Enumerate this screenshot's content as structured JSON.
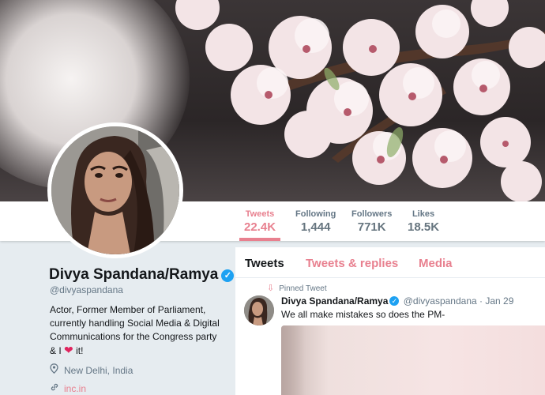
{
  "profile": {
    "name": "Divya Spandana/Ramya",
    "handle": "@divyaspandana",
    "bio_lines": [
      "Actor, Former Member of Parliament,",
      "currently handling Social Media & Digital",
      "Communications for the Congress party"
    ],
    "bio_end_prefix": "& I",
    "bio_end_suffix": "it!",
    "location": "New Delhi, India",
    "website": "inc.in"
  },
  "stats": [
    {
      "label": "Tweets",
      "value": "22.4K",
      "active": true
    },
    {
      "label": "Following",
      "value": "1,444",
      "active": false
    },
    {
      "label": "Followers",
      "value": "771K",
      "active": false
    },
    {
      "label": "Likes",
      "value": "18.5K",
      "active": false
    }
  ],
  "tabs": [
    {
      "label": "Tweets",
      "active": true
    },
    {
      "label": "Tweets & replies",
      "active": false
    },
    {
      "label": "Media",
      "active": false
    }
  ],
  "pinned_tweet": {
    "pinned_label": "Pinned Tweet",
    "name": "Divya Spandana/Ramya",
    "handle": "@divyaspandana",
    "separator": "·",
    "date": "Jan 29",
    "text": "We all make mistakes so does the PM-"
  },
  "colors": {
    "accent": "#e8808f",
    "verified": "#1da1f2",
    "heart": "#e0245e",
    "background": "#e6ecf0"
  },
  "icons": {
    "verified": "verified-badge-icon",
    "location": "location-pin-icon",
    "link": "link-icon",
    "pin": "pin-icon",
    "heart": "heart-icon"
  }
}
